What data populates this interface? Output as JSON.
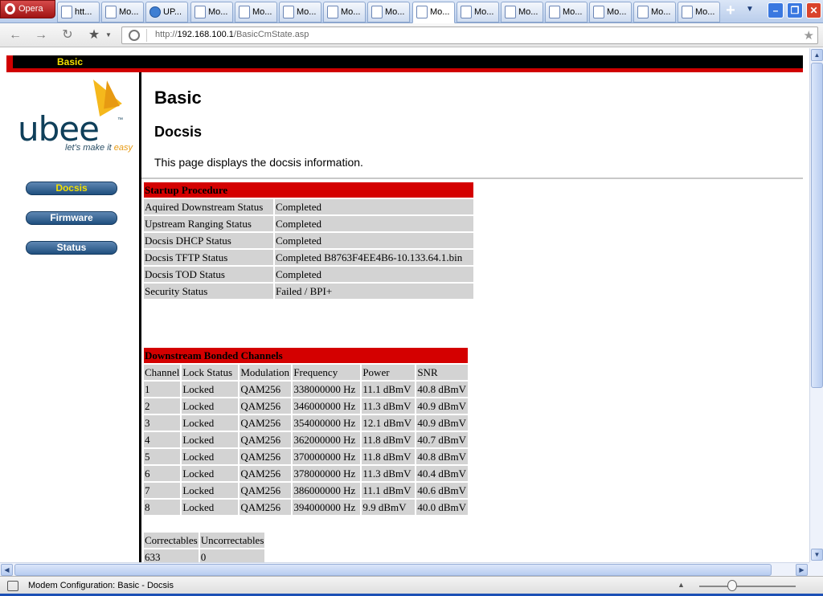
{
  "browser": {
    "menu_label": "Opera",
    "tabs": [
      {
        "label": "htt...",
        "active": false
      },
      {
        "label": "Mo...",
        "active": false
      },
      {
        "label": "UP...",
        "active": false
      },
      {
        "label": "Mo...",
        "active": false
      },
      {
        "label": "Mo...",
        "active": false
      },
      {
        "label": "Mo...",
        "active": false
      },
      {
        "label": "Mo...",
        "active": false
      },
      {
        "label": "Mo...",
        "active": false
      },
      {
        "label": "Mo...",
        "active": true
      },
      {
        "label": "Mo...",
        "active": false
      },
      {
        "label": "Mo...",
        "active": false
      },
      {
        "label": "Mo...",
        "active": false
      },
      {
        "label": "Mo...",
        "active": false
      },
      {
        "label": "Mo...",
        "active": false
      },
      {
        "label": "Mo...",
        "active": false
      }
    ],
    "new_tab_icon": "plus-icon",
    "url_prefix": "http://",
    "url_host": "192.168.100.1",
    "url_path": "/BasicCmState.asp",
    "status_text": "Modem Configuration: Basic - Docsis"
  },
  "page": {
    "top_title": "Basic",
    "logo": {
      "brand": "ubee",
      "tm": "™",
      "tagline_a": "let's make it ",
      "tagline_b": "easy"
    },
    "nav": [
      "Docsis",
      "Firmware",
      "Status"
    ],
    "heading": "Basic",
    "subheading": "Docsis",
    "description": "This page displays the docsis information.",
    "startup": {
      "title": "Startup Procedure",
      "rows": [
        [
          "Aquired Downstream Status",
          "Completed"
        ],
        [
          "Upstream Ranging Status",
          "Completed"
        ],
        [
          "Docsis DHCP Status",
          "Completed"
        ],
        [
          "Docsis TFTP Status",
          "Completed B8763F4EE4B6-10.133.64.1.bin"
        ],
        [
          "Docsis TOD Status",
          "Completed"
        ],
        [
          "Security Status",
          "Failed / BPI+"
        ]
      ]
    },
    "downstream": {
      "title": "Downstream Bonded Channels",
      "columns": [
        "Channel",
        "Lock Status",
        "Modulation",
        "Frequency",
        "Power",
        "SNR"
      ],
      "rows": [
        [
          "1",
          "Locked",
          "QAM256",
          "338000000 Hz",
          "11.1 dBmV",
          "40.8 dBmV"
        ],
        [
          "2",
          "Locked",
          "QAM256",
          "346000000 Hz",
          "11.3 dBmV",
          "40.9 dBmV"
        ],
        [
          "3",
          "Locked",
          "QAM256",
          "354000000 Hz",
          "12.1 dBmV",
          "40.9 dBmV"
        ],
        [
          "4",
          "Locked",
          "QAM256",
          "362000000 Hz",
          "11.8 dBmV",
          "40.7 dBmV"
        ],
        [
          "5",
          "Locked",
          "QAM256",
          "370000000 Hz",
          "11.8 dBmV",
          "40.8 dBmV"
        ],
        [
          "6",
          "Locked",
          "QAM256",
          "378000000 Hz",
          "11.3 dBmV",
          "40.4 dBmV"
        ],
        [
          "7",
          "Locked",
          "QAM256",
          "386000000 Hz",
          "11.1 dBmV",
          "40.6 dBmV"
        ],
        [
          "8",
          "Locked",
          "QAM256",
          "394000000 Hz",
          "9.9 dBmV",
          "40.0 dBmV"
        ]
      ]
    },
    "errors": {
      "columns": [
        "Correctables",
        "Uncorrectables"
      ],
      "values": [
        "633",
        "0"
      ]
    }
  }
}
